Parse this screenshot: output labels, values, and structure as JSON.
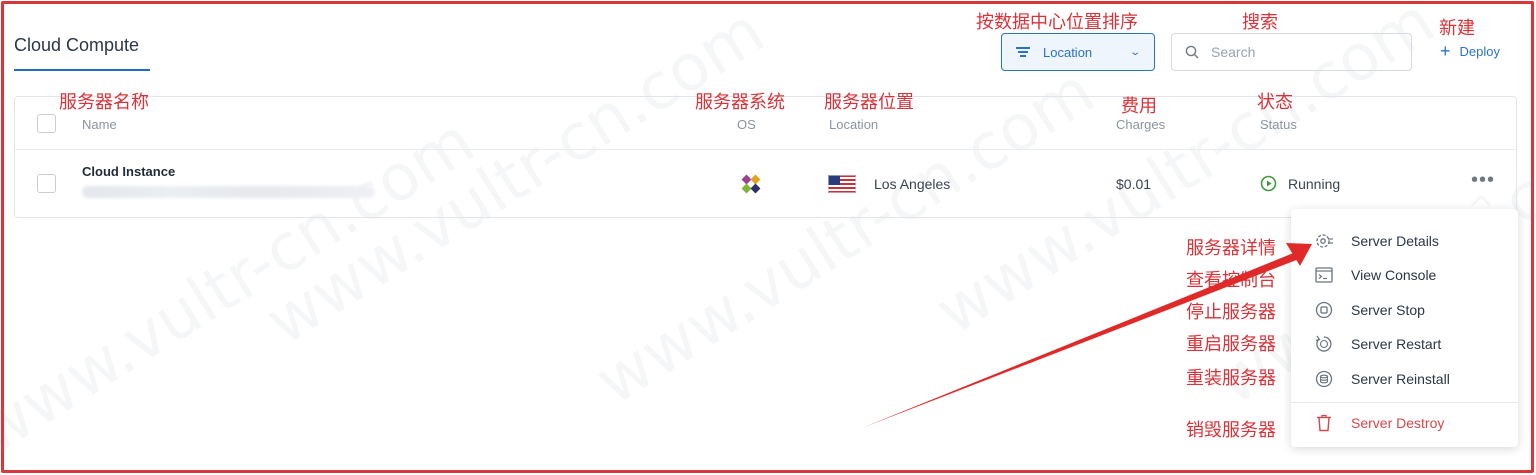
{
  "page": {
    "title": "Cloud Compute"
  },
  "toolbar": {
    "location_filter": "Location",
    "search_placeholder": "Search",
    "deploy_label": "Deploy"
  },
  "table": {
    "headers": {
      "name": "Name",
      "os": "OS",
      "location": "Location",
      "charges": "Charges",
      "status": "Status"
    },
    "rows": [
      {
        "name": "Cloud Instance",
        "location": "Los Angeles",
        "charges": "$0.01",
        "status": "Running"
      }
    ]
  },
  "menu": {
    "items": [
      "Server Details",
      "View Console",
      "Server Stop",
      "Server Restart",
      "Server Reinstall"
    ],
    "destroy": "Server Destroy"
  },
  "annotations": {
    "sort": "按数据中心位置排序",
    "search": "搜索",
    "new": "新建",
    "name": "服务器名称",
    "os": "服务器系统",
    "location": "服务器位置",
    "charges": "费用",
    "status": "状态",
    "details": "服务器详情",
    "console": "查看控制台",
    "stop": "停止服务器",
    "restart": "重启服务器",
    "reinstall": "重装服务器",
    "destroy": "销毁服务器"
  },
  "watermark": "www.vultr-cn.com",
  "colors": {
    "accent": "#2a73c8",
    "annotation": "#d9333a",
    "running": "#3f9a3f",
    "danger": "#d8474a"
  }
}
